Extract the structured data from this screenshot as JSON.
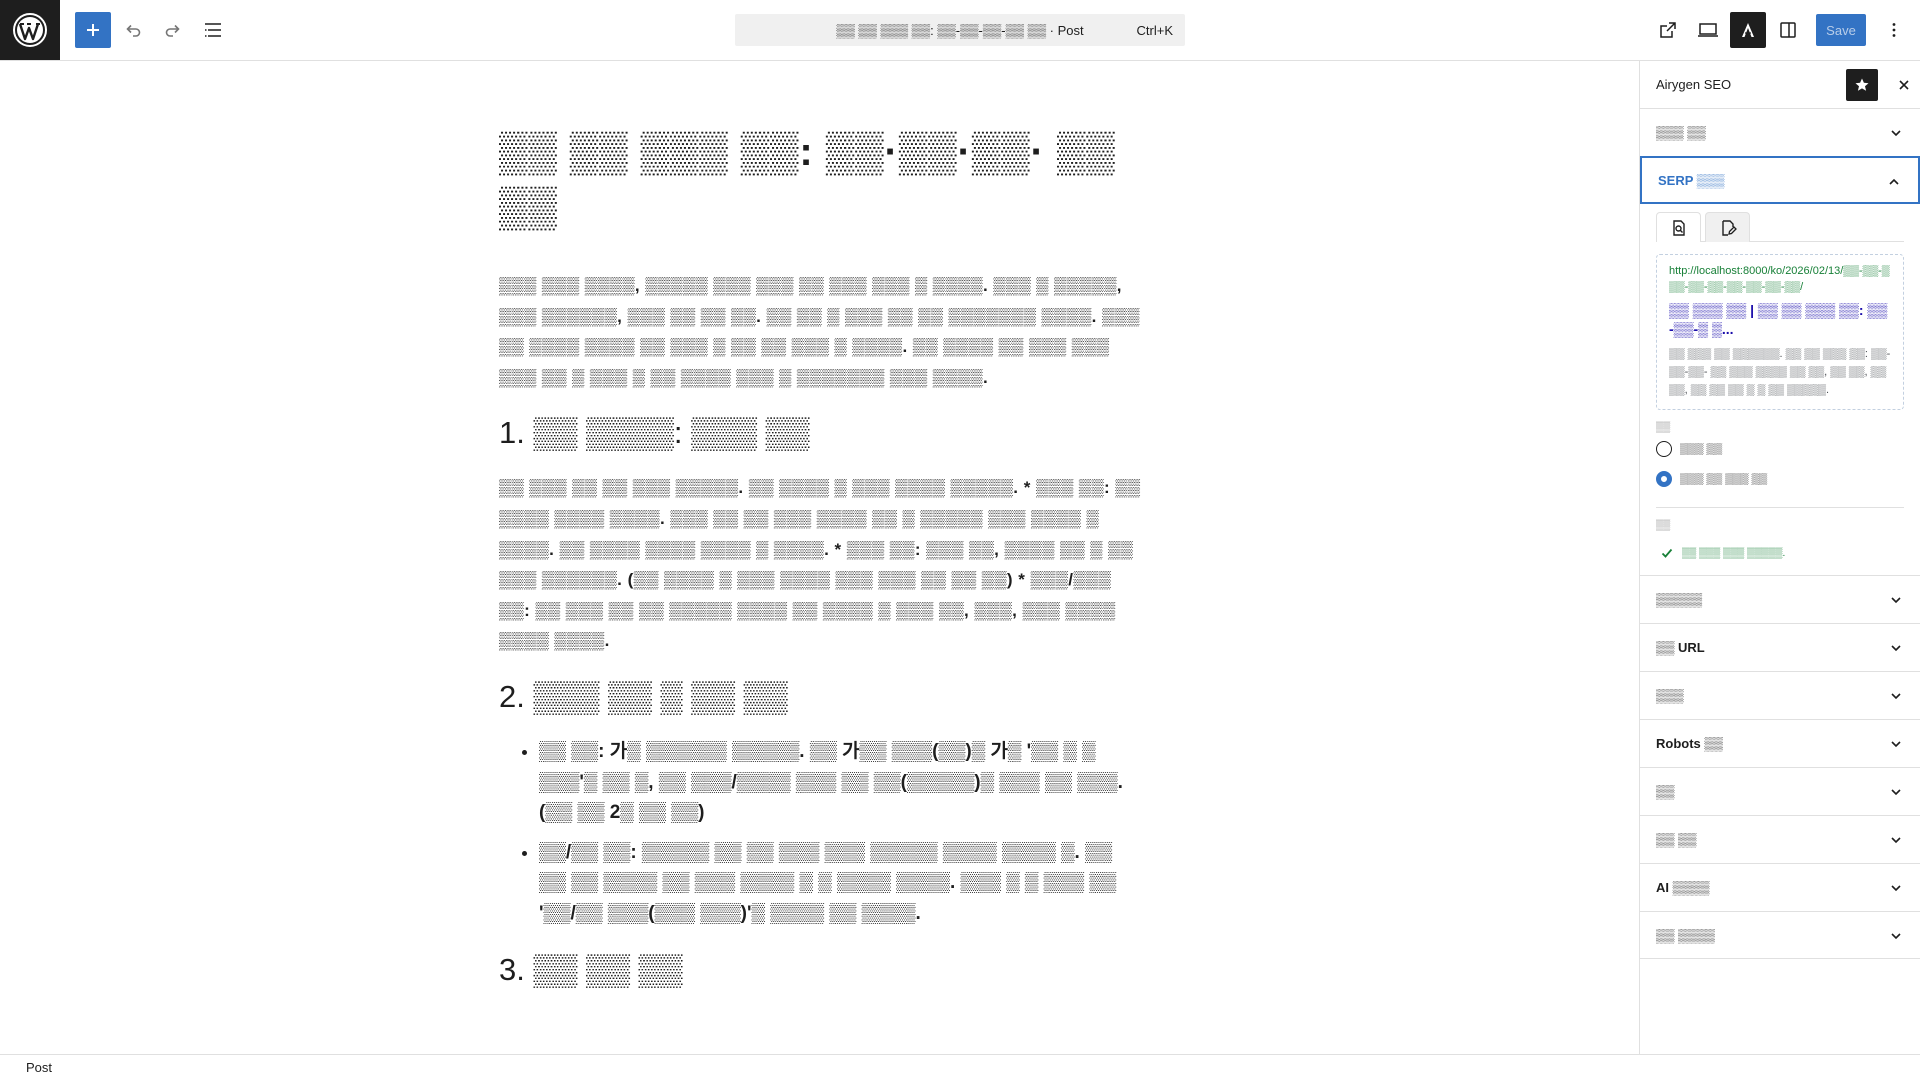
{
  "topbar": {
    "add_icon": "plus-icon",
    "undo_icon": "undo-icon",
    "redo_icon": "redo-icon",
    "list_view_icon": "list-view-icon",
    "command_text": "▒▒ ▒▒ ▒▒▒ ▒▒: ▒▒-▒▒-▒▒-▒▒ ▒▒ · Post",
    "shortcut": "Ctrl+K",
    "save_label": "Save",
    "accent_color": "#3373c4"
  },
  "post": {
    "title": "▒▒ ▒▒ ▒▒▒ ▒▒: ▒▒·▒▒·▒▒· ▒▒ ▒▒",
    "intro": "▒▒▒ ▒▒▒ ▒▒▒▒, ▒▒▒▒▒ ▒▒▒ ▒▒▒ ▒▒ ▒▒▒ ▒▒▒ ▒ ▒▒▒▒. ▒▒▒ ▒ ▒▒▒▒▒, ▒▒▒ ▒▒▒▒▒▒, ▒▒▒ ▒▒ ▒▒ ▒▒. ▒▒ ▒▒ ▒ ▒▒▒ ▒▒ ▒▒ ▒▒▒▒▒▒▒ ▒▒▒▒. ▒▒▒ ▒▒ ▒▒▒▒ ▒▒▒▒ ▒▒ ▒▒▒ ▒ ▒▒ ▒▒ ▒▒▒ ▒ ▒▒▒▒. ▒▒ ▒▒▒▒ ▒▒ ▒▒▒ ▒▒▒ ▒▒▒ ▒▒ ▒ ▒▒▒ ▒ ▒▒ ▒▒▒▒ ▒▒▒ ▒ ▒▒▒▒▒▒▒ ▒▒▒ ▒▒▒▒.",
    "h1": "1. ▒▒ ▒▒▒▒: ▒▒▒ ▒▒",
    "p1": "▒▒ ▒▒▒ ▒▒ ▒▒ ▒▒▒ ▒▒▒▒▒. ▒▒ ▒▒▒▒ ▒ ▒▒▒ ▒▒▒▒ ▒▒▒▒▒. * ▒▒▒ ▒▒: ▒▒ ▒▒▒▒ ▒▒▒▒ ▒▒▒▒. ▒▒▒ ▒▒ ▒▒ ▒▒▒ ▒▒▒▒ ▒▒ ▒ ▒▒▒▒▒ ▒▒▒ ▒▒▒▒ ▒ ▒▒▒▒. ▒▒ ▒▒▒▒ ▒▒▒▒ ▒▒▒▒ ▒ ▒▒▒▒. * ▒▒▒ ▒▒: ▒▒▒ ▒▒, ▒▒▒▒ ▒▒ ▒ ▒▒ ▒▒▒ ▒▒▒▒▒▒. (▒▒ ▒▒▒▒ ▒ ▒▒▒ ▒▒▒▒ ▒▒▒ ▒▒▒ ▒▒ ▒▒ ▒▒) * ▒▒▒/▒▒▒ ▒▒: ▒▒ ▒▒▒ ▒▒ ▒▒ ▒▒▒▒▒ ▒▒▒▒ ▒▒ ▒▒▒▒ ▒ ▒▒▒ ▒▒, ▒▒▒, ▒▒▒ ▒▒▒▒ ▒▒▒▒ ▒▒▒▒.",
    "h2": "2. ▒▒▒ ▒▒ ▒ ▒▒ ▒▒",
    "li1": "▒▒ ▒▒: 가▒ ▒▒▒▒▒▒ ▒▒▒▒▒. ▒▒ 가▒▒ ▒▒▒(▒▒)▒ 가▒ '▒▒ ▒ ▒ ▒▒▒'▒ ▒▒ ▒, ▒▒ ▒▒▒/▒▒▒▒ ▒▒▒ ▒▒ ▒▒(▒▒▒▒▒)▒ ▒▒▒ ▒▒ ▒▒▒. (▒▒ ▒▒ 2▒ ▒▒ ▒▒)",
    "li2": "▒▒/▒▒ ▒▒: ▒▒▒▒▒ ▒▒ ▒▒ ▒▒▒ ▒▒▒ ▒▒▒▒▒ ▒▒▒▒ ▒▒▒▒ ▒. ▒▒ ▒▒ ▒▒ ▒▒▒▒ ▒▒ ▒▒▒ ▒▒▒▒ ▒ ▒ ▒▒▒▒ ▒▒▒▒. ▒▒▒ ▒ ▒ ▒▒▒ ▒▒ '▒▒/▒▒ ▒▒▒(▒▒▒ ▒▒▒)'▒ ▒▒▒▒ ▒▒ ▒▒▒▒.",
    "h3": "3. ▒▒ ▒▒ ▒▒"
  },
  "sidebar": {
    "title": "Airygen SEO",
    "panels_top": [
      "▒▒▒ ▒▒"
    ],
    "serp": {
      "label": "SERP ▒▒▒",
      "url": "http://localhost:8000/ko/2026/02/13/▒▒-▒▒-▒▒▒-▒▒-▒▒-▒▒-▒▒-▒▒-▒▒/",
      "title": "▒▒ ▒▒▒ ▒▒ | ▒▒ ▒▒ ▒▒▒ ▒▒: ▒▒-▒▒-▒ ▒...",
      "desc": "▒▒ ▒▒▒ ▒▒ ▒▒▒▒▒▒. ▒▒ ▒▒ ▒▒▒ ▒▒: ▒▒-▒▒-▒▒- ▒▒ ▒▒▒ ▒▒▒▒ ▒▒ ▒▒, ▒▒ ▒▒, ▒▒ ▒▒, ▒▒ ▒▒ ▒▒ ▒ ▒ ▒▒ ▒▒▒▒▒.",
      "device_label": "▒▒",
      "radio_1": "▒▒▒ ▒▒",
      "radio_2": "▒▒▒ ▒▒ ▒▒▒ ▒▒",
      "status_label": "▒▒",
      "status_ok": "▒▒ ▒▒▒ ▒▒▒ ▒▒▒▒▒."
    },
    "panels": [
      "▒▒▒▒▒",
      "▒▒ URL",
      "▒▒▒",
      "Robots ▒▒",
      "▒▒",
      "▒▒ ▒▒",
      "AI ▒▒▒▒",
      "▒▒ ▒▒▒▒"
    ]
  },
  "footer": {
    "breadcrumb": "Post"
  }
}
